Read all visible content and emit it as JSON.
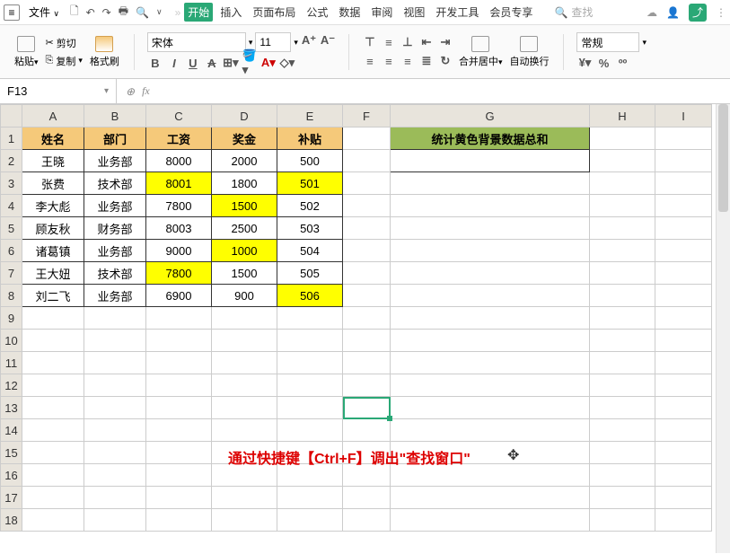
{
  "menubar": {
    "file": "文件",
    "tabs": [
      "开始",
      "插入",
      "页面布局",
      "公式",
      "数据",
      "审阅",
      "视图",
      "开发工具",
      "会员专享"
    ],
    "active_tab": 0,
    "search_placeholder": "查找"
  },
  "ribbon": {
    "paste": "粘贴",
    "cut": "剪切",
    "copy": "复制",
    "format_painter": "格式刷",
    "font": "宋体",
    "size": "11",
    "merge": "合并居中",
    "wrap": "自动换行",
    "number_format": "常规"
  },
  "namebox": "F13",
  "columns": [
    "A",
    "B",
    "C",
    "D",
    "E",
    "F",
    "G",
    "H",
    "I"
  ],
  "rows": 18,
  "headers": [
    "姓名",
    "部门",
    "工资",
    "奖金",
    "补贴"
  ],
  "data_rows": [
    {
      "name": "王晓",
      "dept": "业务部",
      "salary": "8000",
      "bonus": "2000",
      "allow": "500",
      "y_salary": false,
      "y_bonus": false,
      "y_allow": false
    },
    {
      "name": "张费",
      "dept": "技术部",
      "salary": "8001",
      "bonus": "1800",
      "allow": "501",
      "y_salary": true,
      "y_bonus": false,
      "y_allow": true
    },
    {
      "name": "李大彪",
      "dept": "业务部",
      "salary": "7800",
      "bonus": "1500",
      "allow": "502",
      "y_salary": false,
      "y_bonus": true,
      "y_allow": false
    },
    {
      "name": "顾友秋",
      "dept": "财务部",
      "salary": "8003",
      "bonus": "2500",
      "allow": "503",
      "y_salary": false,
      "y_bonus": false,
      "y_allow": false
    },
    {
      "name": "诸葛镇",
      "dept": "业务部",
      "salary": "9000",
      "bonus": "1000",
      "allow": "504",
      "y_salary": false,
      "y_bonus": true,
      "y_allow": false
    },
    {
      "name": "王大妞",
      "dept": "技术部",
      "salary": "7800",
      "bonus": "1500",
      "allow": "505",
      "y_salary": true,
      "y_bonus": false,
      "y_allow": false
    },
    {
      "name": "刘二飞",
      "dept": "业务部",
      "salary": "6900",
      "bonus": "900",
      "allow": "506",
      "y_salary": false,
      "y_bonus": false,
      "y_allow": true
    }
  ],
  "green_label": "统计黄色背景数据总和",
  "overlay": "通过快捷键【Ctrl+F】调出\"查找窗口\"",
  "selected_cell": {
    "row": 13,
    "col": "F"
  }
}
